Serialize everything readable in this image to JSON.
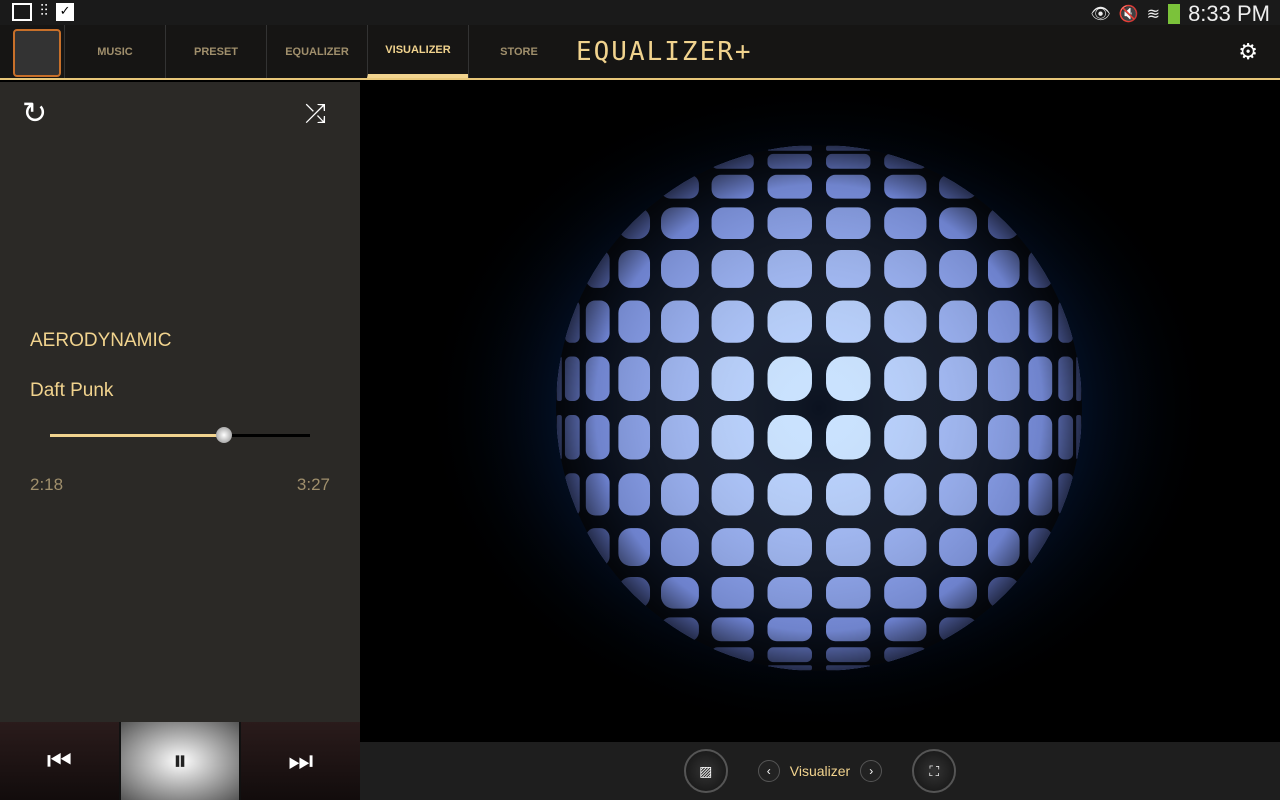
{
  "status": {
    "time": "8:33 PM",
    "icons": [
      "image-icon",
      "sliders-icon",
      "shopping-bag-icon",
      "eye-icon",
      "mute-icon",
      "wifi-icon",
      "battery-icon"
    ]
  },
  "nav": {
    "tabs": [
      "MUSIC",
      "PRESET",
      "EQUALIZER",
      "VISUALIZER",
      "STORE"
    ],
    "active": "VISUALIZER",
    "brand": "EQUALIZER+"
  },
  "player": {
    "title": "AERODYNAMIC",
    "artist": "Daft Punk",
    "elapsed": "2:18",
    "duration": "3:27",
    "progress_percent": 67
  },
  "visualizer": {
    "mode_label": "Visualizer"
  },
  "colors": {
    "accent": "#f1d38e",
    "panel": "#2b2926"
  }
}
